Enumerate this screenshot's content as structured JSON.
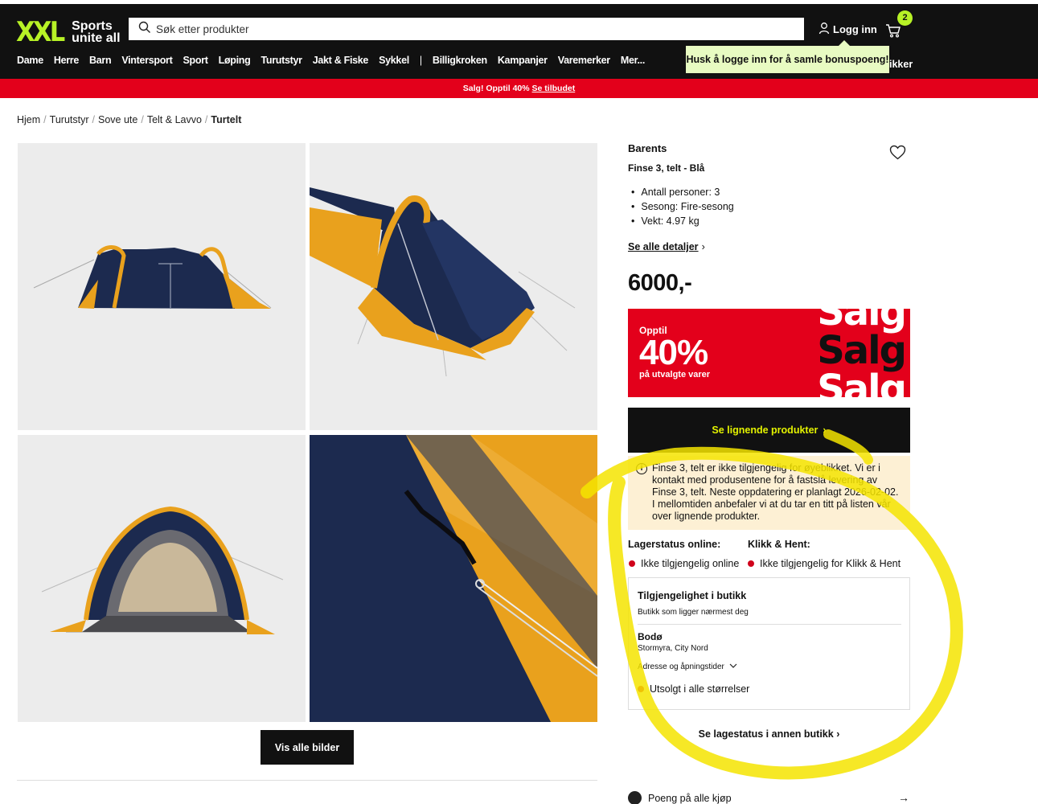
{
  "header": {
    "logo_mark": "XXL",
    "logo_line1": "Sports",
    "logo_line2": "unite all",
    "search_placeholder": "Søk etter produkter",
    "login_label": "Logg inn",
    "cart_count": "2",
    "tooltip": "Husk å logge inn for å samle bonuspoeng!",
    "nav": [
      "Dame",
      "Herre",
      "Barn",
      "Vintersport",
      "Sport",
      "Løping",
      "Turutstyr",
      "Jakt & Fiske",
      "Sykkel"
    ],
    "nav_after_sep": [
      "Billigkroken",
      "Kampanjer",
      "Varemerker",
      "Mer..."
    ],
    "nav_extra": "ikker"
  },
  "promo_bar": {
    "text": "Salg! Opptil 40%",
    "link": "Se tilbudet"
  },
  "breadcrumb": [
    "Hjem",
    "Turutstyr",
    "Sove ute",
    "Telt & Lavvo"
  ],
  "breadcrumb_current": "Turtelt",
  "gallery": {
    "show_all_label": "Vis alle bilder"
  },
  "product": {
    "brand": "Barents",
    "name": "Finse 3, telt - Blå",
    "specs": [
      "Antall personer: 3",
      "Sesong: Fire-sesong",
      "Vekt: 4.97 kg"
    ],
    "details_link": "Se alle detaljer",
    "price": "6000,-"
  },
  "sale_banner": {
    "upto": "Opptil",
    "percent": "40%",
    "sub": "på utvalgte varer",
    "word": "Salg"
  },
  "similar_button": "Se lignende produkter",
  "notice": "Finse 3, telt er ikke tilgjengelig for øyeblikket. Vi er i kontakt med produsentene for å fastslå levering av Finse 3, telt. Neste oppdatering er planlagt 2026-02-02. I mellomtiden anbefaler vi at du tar en titt på listen vår over lignende produkter.",
  "stock": {
    "online_label": "Lagerstatus online:",
    "cc_label": "Klikk & Hent:",
    "online_value": "Ikke tilgjengelig online",
    "cc_value": "Ikke tilgjengelig for Klikk & Hent"
  },
  "store": {
    "title": "Tilgjengelighet i butikk",
    "subtitle": "Butikk som ligger nærmest deg",
    "city": "Bodø",
    "address": "Stormyra, City Nord",
    "hours_label": "Adresse og åpningstider",
    "status": "Utsolgt i alle størrelser"
  },
  "other_store_link": "Se lagestatus i annen butikk",
  "points": "Poeng på alle kjøp",
  "colors": {
    "brand_green": "#b7f226",
    "sale_red": "#e3001b",
    "dark": "#111111",
    "highlight_yellow": "#f5e400"
  }
}
